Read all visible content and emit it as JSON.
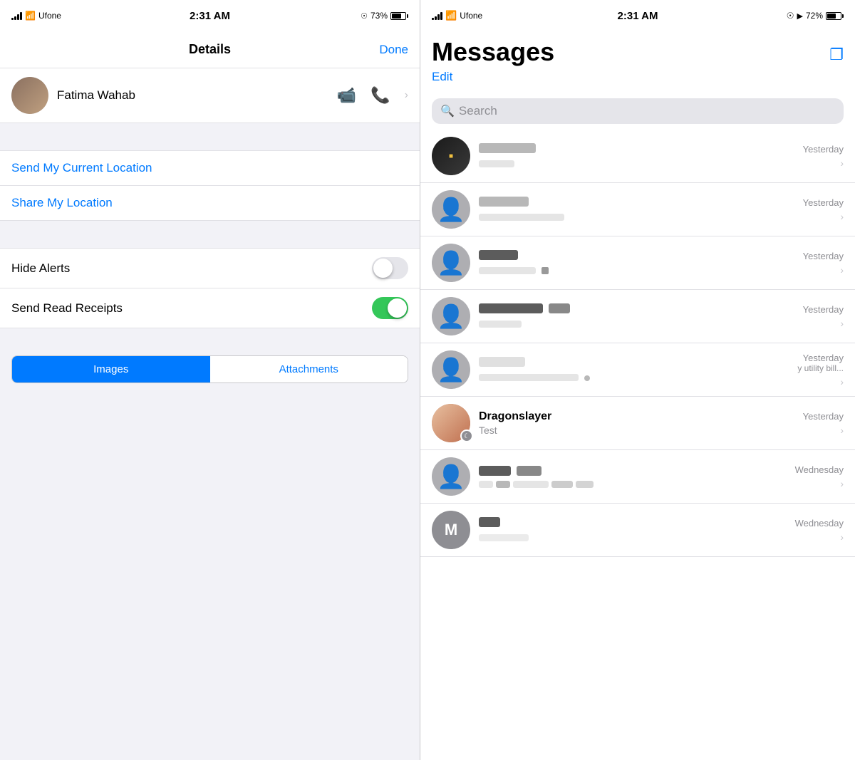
{
  "left": {
    "status_bar": {
      "carrier": "Ufone",
      "time": "2:31 AM",
      "battery": "73%"
    },
    "nav": {
      "title": "Details",
      "done_label": "Done"
    },
    "contact": {
      "name": "Fatima Wahab"
    },
    "list_items": [
      {
        "label": "Send My Current Location"
      },
      {
        "label": "Share My Location"
      }
    ],
    "toggle_items": [
      {
        "label": "Hide Alerts",
        "state": "off"
      },
      {
        "label": "Send Read Receipts",
        "state": "on"
      }
    ],
    "segments": [
      {
        "label": "Images",
        "active": true
      },
      {
        "label": "Attachments",
        "active": false
      }
    ]
  },
  "right": {
    "status_bar": {
      "carrier": "Ufone",
      "time": "2:31 AM",
      "battery": "72%"
    },
    "header": {
      "title": "Messages",
      "edit_label": "Edit"
    },
    "search": {
      "placeholder": "Search"
    },
    "conversations": [
      {
        "name": "redacted1",
        "preview": "redacted_preview1",
        "time": "Yesterday",
        "has_avatar": true,
        "avatar_type": "photo_dark"
      },
      {
        "name": "redacted2",
        "preview": "redacted_preview2",
        "time": "Yesterday",
        "has_avatar": true,
        "avatar_type": "gray_person"
      },
      {
        "name": "redacted3",
        "preview": "redacted_preview3",
        "time": "Yesterday",
        "has_avatar": true,
        "avatar_type": "gray_person"
      },
      {
        "name": "redacted4",
        "preview": "redacted_preview4",
        "time": "Yesterday",
        "has_avatar": true,
        "avatar_type": "gray_person"
      },
      {
        "name": "redacted5",
        "preview": "y utility bill...",
        "time": "Yesterday",
        "has_avatar": true,
        "avatar_type": "gray_person"
      },
      {
        "name": "Dragonslayer",
        "preview": "Test",
        "time": "Yesterday",
        "has_avatar": true,
        "avatar_type": "custom_photo",
        "has_moon": true
      },
      {
        "name": "redacted6",
        "preview": "redacted_preview6",
        "time": "Wednesday",
        "has_avatar": true,
        "avatar_type": "gray_person"
      },
      {
        "name": "M",
        "preview": "redacted_preview7",
        "time": "Wednesday",
        "has_avatar": true,
        "avatar_type": "letter"
      }
    ]
  }
}
